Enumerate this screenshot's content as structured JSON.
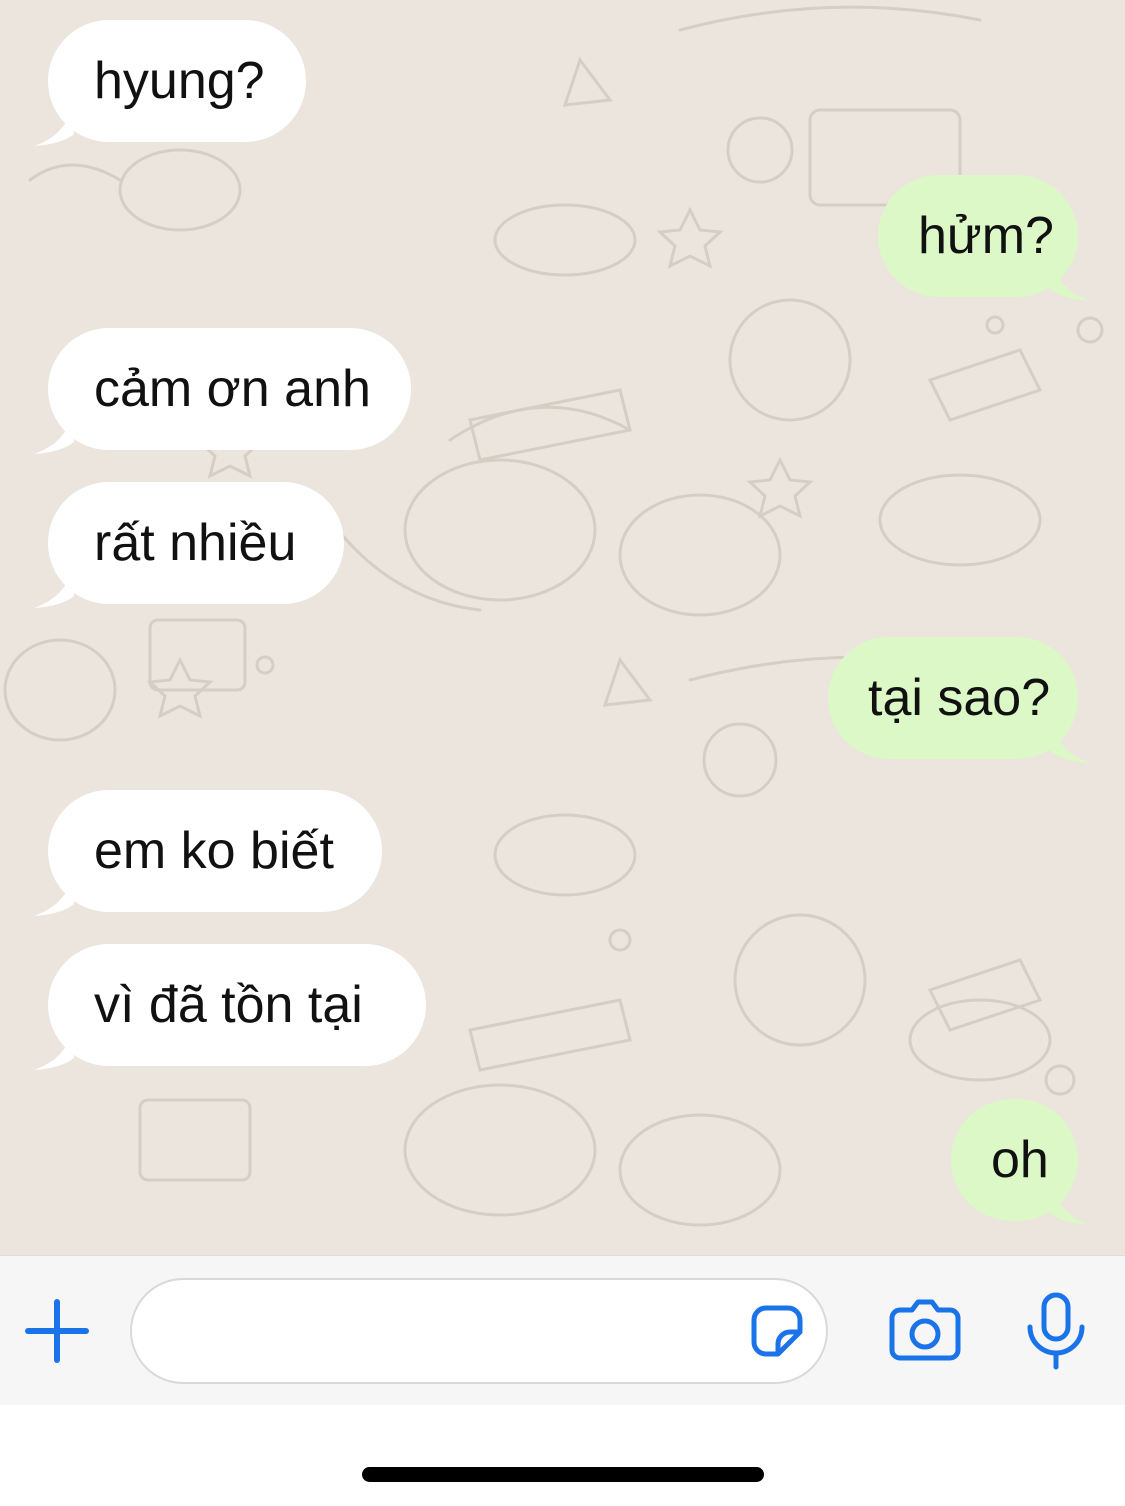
{
  "colors": {
    "chat_background": "#ECE5DD",
    "incoming_bubble": "#FFFFFF",
    "outgoing_bubble": "#DCF8C6",
    "accent_icon": "#1A73E8",
    "input_bar": "#F6F6F6"
  },
  "messages": [
    {
      "direction": "incoming",
      "text": "hyung?"
    },
    {
      "direction": "outgoing",
      "text": "hửm?"
    },
    {
      "direction": "incoming",
      "text": "cảm ơn anh"
    },
    {
      "direction": "incoming",
      "text": "rất nhiều"
    },
    {
      "direction": "outgoing",
      "text": "tại sao?"
    },
    {
      "direction": "incoming",
      "text": "em ko biết"
    },
    {
      "direction": "incoming",
      "text": "vì đã tồn tại"
    },
    {
      "direction": "outgoing",
      "text": "oh"
    }
  ],
  "input_bar": {
    "message_value": "",
    "icons": {
      "plus": "plus-icon",
      "sticker": "sticker-icon",
      "camera": "camera-icon",
      "microphone": "microphone-icon"
    }
  }
}
